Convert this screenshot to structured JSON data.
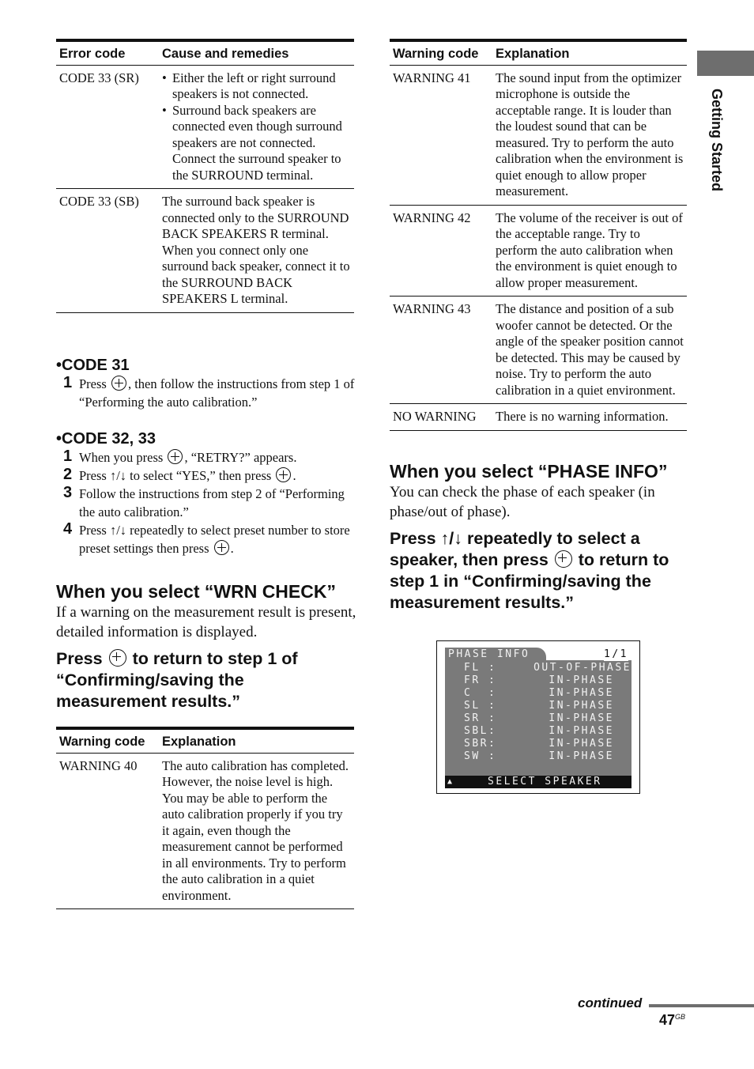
{
  "side_tab": {
    "label": "Getting Started",
    "color": "#6e6e6e"
  },
  "error_table": {
    "headers": [
      "Error code",
      "Cause and remedies"
    ],
    "rows": [
      {
        "code": "CODE 33 (SR)",
        "bullets": [
          "Either the left or right surround speakers is not connected.",
          "Surround back speakers are connected even though surround speakers are not connected. Connect the surround speaker to the SURROUND terminal."
        ]
      },
      {
        "code": "CODE 33 (SB)",
        "text": "The surround back speaker is connected only to the SURROUND BACK SPEAKERS R terminal. When you connect only one surround back speaker, connect it to the SURROUND BACK SPEAKERS L terminal."
      }
    ]
  },
  "code31": {
    "title": "•CODE 31",
    "steps": [
      {
        "num": "1",
        "pre": "Press",
        "post": ", then follow the instructions from step 1 of “Performing the auto calibration.”"
      }
    ]
  },
  "code3233": {
    "title": "•CODE 32, 33",
    "steps": [
      {
        "num": "1",
        "pre": "When you press",
        "post": ", “RETRY?” appears."
      },
      {
        "num": "2",
        "pre": "Press ↑/↓ to select “YES,” then press",
        "post": "."
      },
      {
        "num": "3",
        "text": "Follow the instructions from step 2 of “Performing the auto calibration.”"
      },
      {
        "num": "4",
        "pre": "Press ↑/↓ repeatedly to select preset number to store preset settings then press",
        "post": "."
      }
    ]
  },
  "wrn_section": {
    "heading": "When you select “WRN CHECK”",
    "body": "If a warning on the measurement result is present, detailed information is displayed.",
    "instruction_pre": "Press",
    "instruction_post": "to return to step 1 of “Confirming/saving the measurement results.”"
  },
  "warning_table_left": {
    "headers": [
      "Warning code",
      "Explanation"
    ],
    "rows": [
      {
        "code": "WARNING 40",
        "text": "The auto calibration has completed. However, the noise level is high. You may be able to perform the auto calibration properly if you try it again, even though the measurement cannot be performed in all environments. Try to perform the auto calibration in a quiet environment."
      }
    ]
  },
  "warning_table_right": {
    "headers": [
      "Warning code",
      "Explanation"
    ],
    "rows": [
      {
        "code": "WARNING 41",
        "text": "The sound input from the optimizer microphone is outside the acceptable range. It is louder than the loudest sound that can be measured. Try to perform the auto calibration when the environment is quiet enough to allow proper measurement."
      },
      {
        "code": "WARNING 42",
        "text": "The volume of the receiver is out of the acceptable range. Try to perform the auto calibration when the environment is quiet enough to allow proper measurement."
      },
      {
        "code": "WARNING 43",
        "text": "The distance and position of a sub woofer cannot be detected. Or the angle of the speaker position cannot be detected. This may be caused by noise. Try to perform the auto calibration in a quiet environment."
      },
      {
        "code": "NO WARNING",
        "text": "There is no warning information."
      }
    ]
  },
  "phase_section": {
    "heading": "When you select “PHASE INFO”",
    "body": "You can check the phase of each speaker (in phase/out of phase).",
    "instruction_a": "Press ↑/↓ repeatedly to select a speaker, then press",
    "instruction_b": "to return to step 1 in “Confirming/saving the measurement results.”"
  },
  "phase_screen": {
    "title": "PHASE INFO",
    "page": "1/1",
    "rows": [
      {
        "speaker": "FL",
        "status": "OUT-OF-PHASE"
      },
      {
        "speaker": "FR",
        "status": "IN-PHASE"
      },
      {
        "speaker": "C",
        "status": "IN-PHASE"
      },
      {
        "speaker": "SL",
        "status": "IN-PHASE"
      },
      {
        "speaker": "SR",
        "status": "IN-PHASE"
      },
      {
        "speaker": "SBL",
        "status": "IN-PHASE"
      },
      {
        "speaker": "SBR",
        "status": "IN-PHASE"
      },
      {
        "speaker": "SW",
        "status": "IN-PHASE"
      }
    ],
    "footer": "SELECT SPEAKER"
  },
  "footer": {
    "continued": "continued",
    "page_number": "47",
    "page_suffix": "GB"
  }
}
